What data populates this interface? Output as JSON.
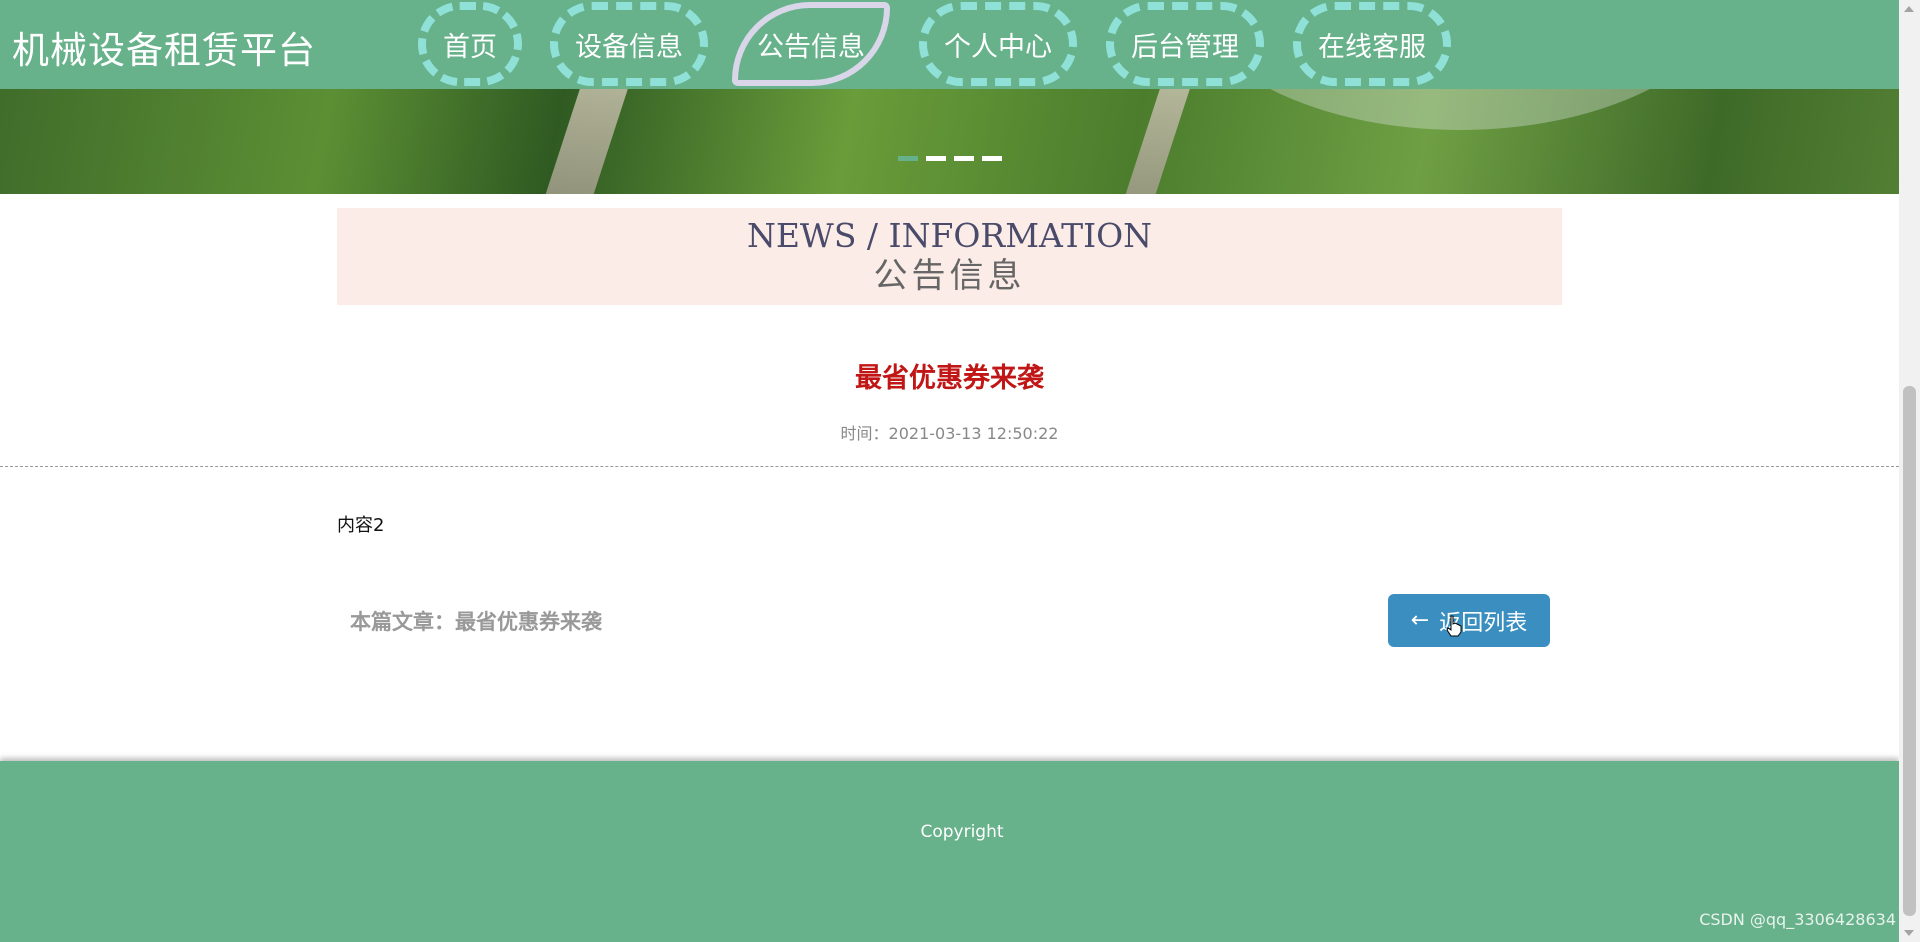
{
  "header": {
    "logo": "机械设备租赁平台",
    "nav": [
      {
        "label": "首页"
      },
      {
        "label": "设备信息"
      },
      {
        "label": "公告信息",
        "active": true
      },
      {
        "label": "个人中心"
      },
      {
        "label": "后台管理"
      },
      {
        "label": "在线客服"
      }
    ],
    "carousel": {
      "slide_count": 4,
      "active_index": 0
    }
  },
  "section": {
    "title_en": "NEWS / INFORMATION",
    "title_cn": "公告信息"
  },
  "article": {
    "title": "最省优惠券来袭",
    "time": "时间：2021-03-13 12:50:22",
    "content": "内容2",
    "current": "本篇文章：最省优惠券来袭",
    "back_label": "返回列表"
  },
  "footer": {
    "copyright": "Copyright",
    "watermark": "CSDN @qq_3306428634"
  },
  "colors": {
    "primary": "#67b18b",
    "accent_red": "#c01616",
    "button_blue": "#3a8fc0",
    "title_bg": "#fcece7",
    "nav_border": "#8fe1d7"
  },
  "icons": {
    "back": "arrow-left-icon",
    "cursor": "hand-cursor-icon"
  }
}
